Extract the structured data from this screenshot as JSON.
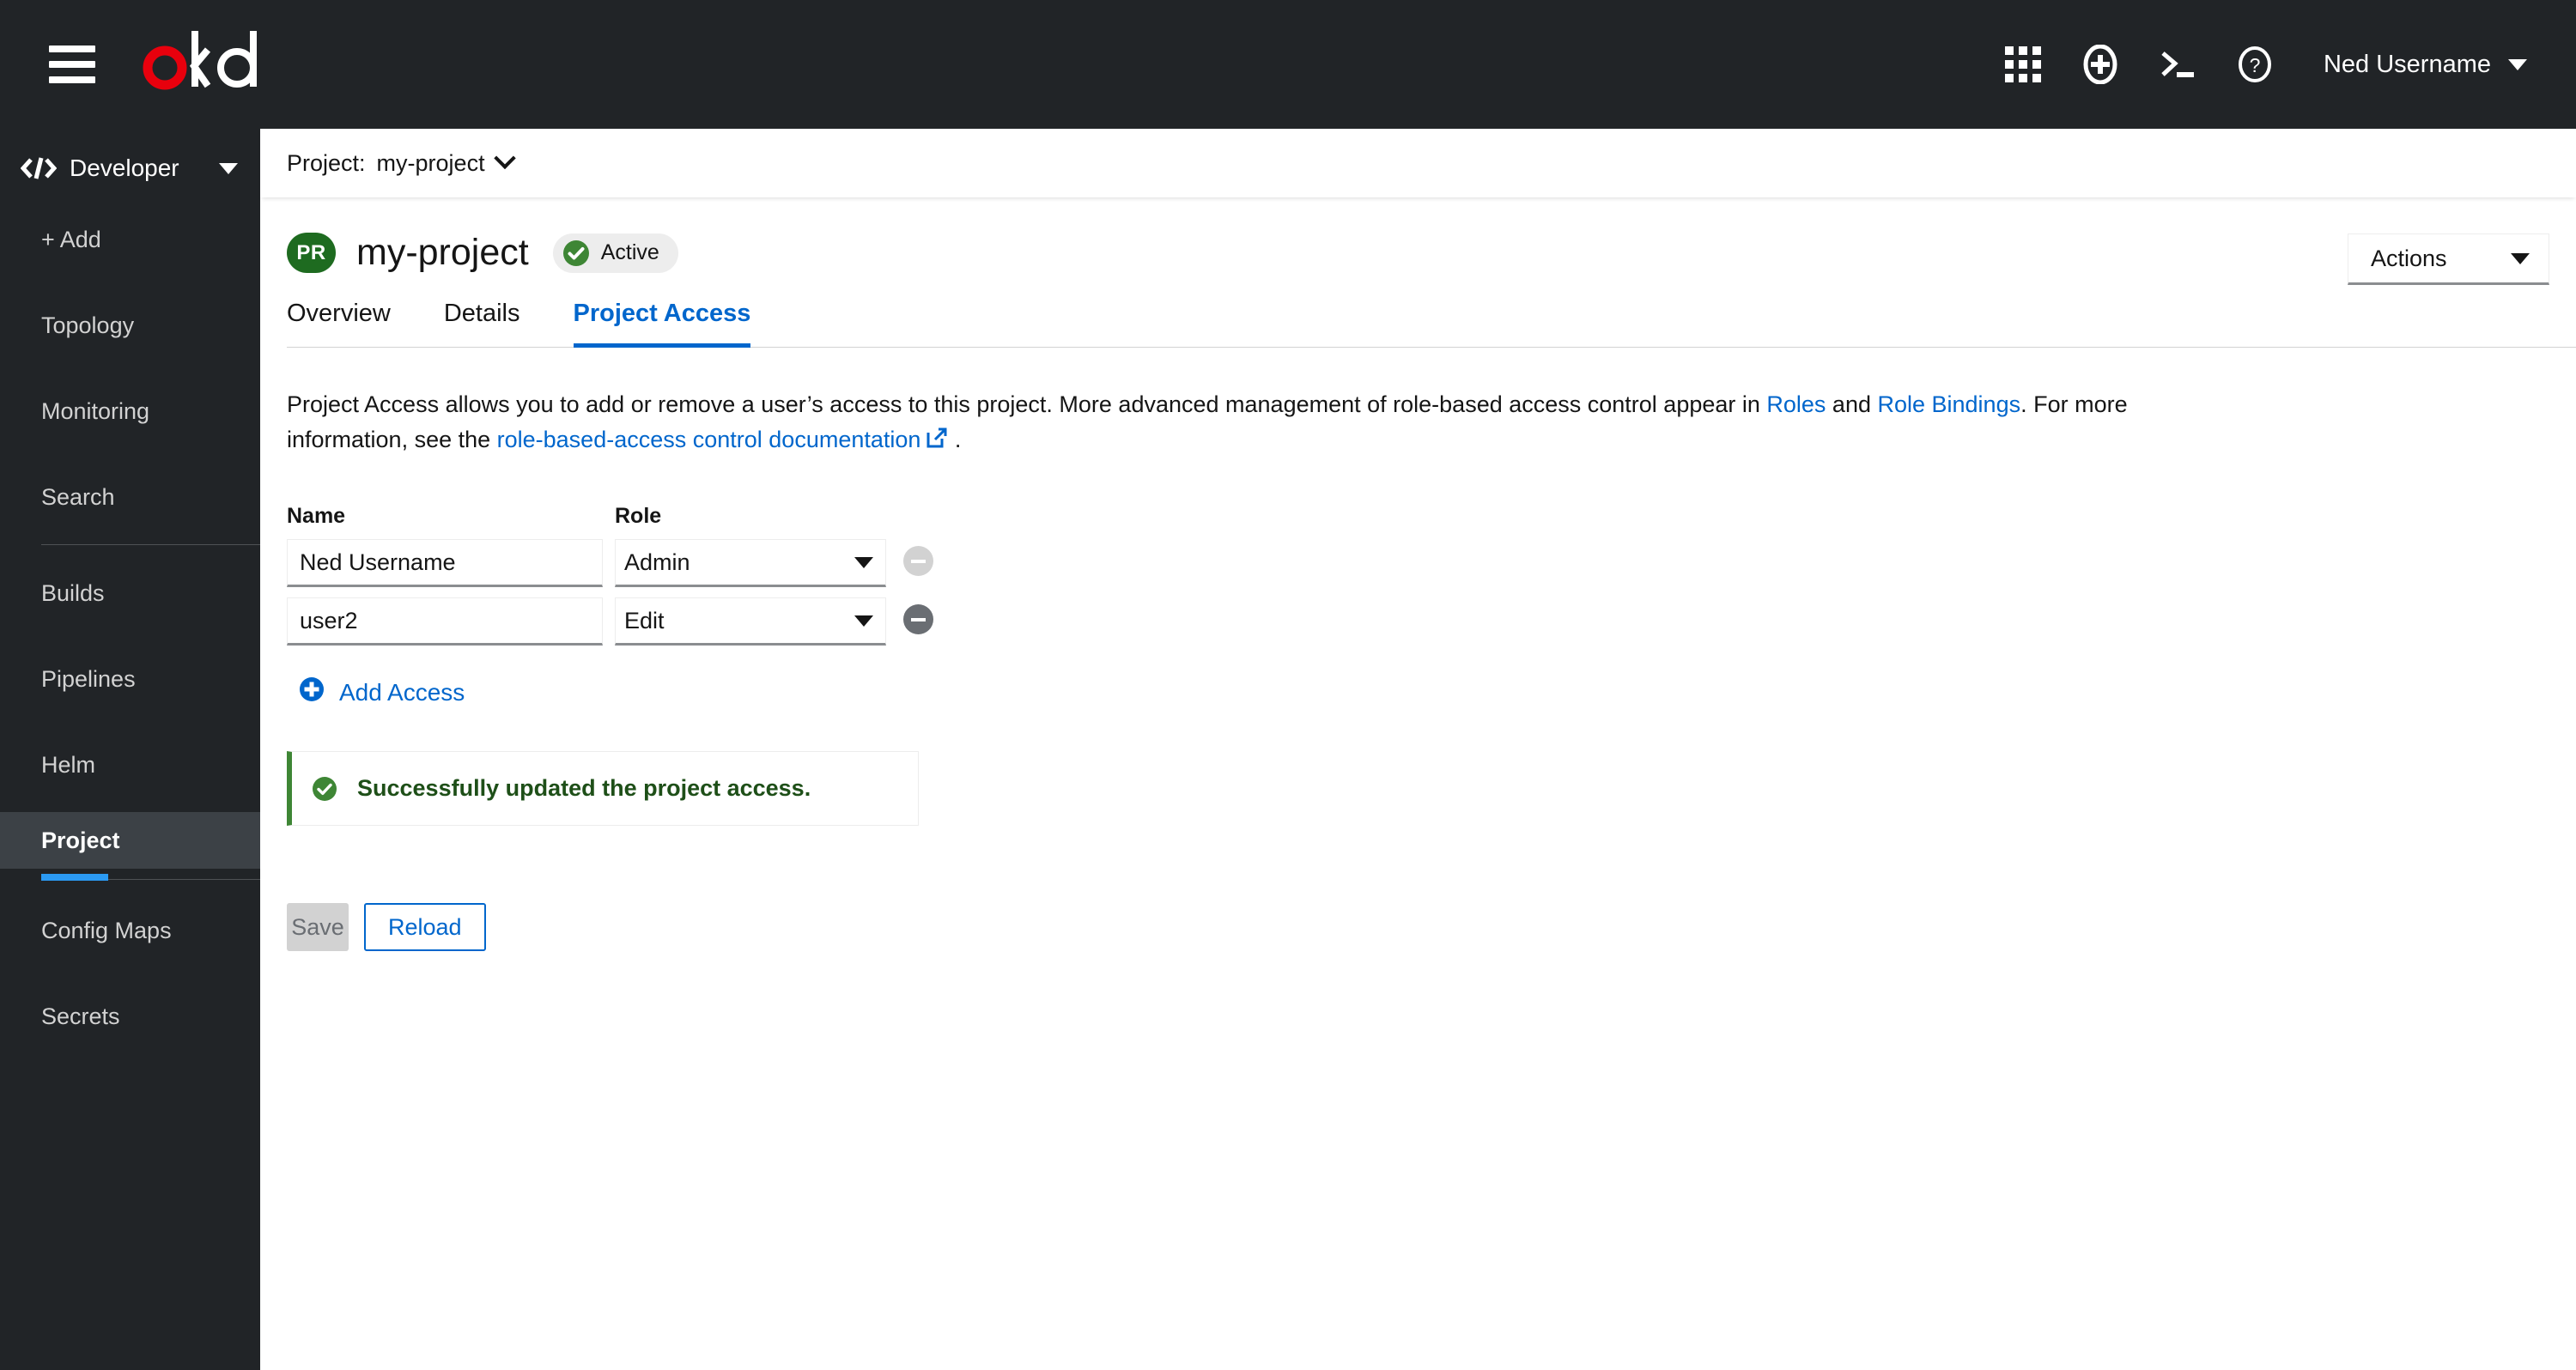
{
  "masthead": {
    "brand_name": "okd",
    "hamburger_label": "Toggle navigation",
    "icons": [
      {
        "name": "application-launcher-icon",
        "label": "Application launcher"
      },
      {
        "name": "plus-circle-icon",
        "label": "Quick create"
      },
      {
        "name": "terminal-icon",
        "label": "Command line terminal"
      },
      {
        "name": "help-icon",
        "label": "Help"
      }
    ],
    "user_name": "Ned Username"
  },
  "sidebar": {
    "perspective": "Developer",
    "items": [
      {
        "label": "+ Add",
        "active": false
      },
      {
        "label": "Topology",
        "active": false
      },
      {
        "label": "Monitoring",
        "active": false
      },
      {
        "label": "Search",
        "active": false
      },
      {
        "label": "Builds",
        "active": false
      },
      {
        "label": "Pipelines",
        "active": false
      },
      {
        "label": "Helm",
        "active": false
      },
      {
        "label": "Project",
        "active": true
      },
      {
        "label": "Config Maps",
        "active": false
      },
      {
        "label": "Secrets",
        "active": false
      }
    ]
  },
  "project_bar": {
    "label": "Project:",
    "value": "my-project"
  },
  "page": {
    "badge": "PR",
    "title": "my-project",
    "status": "Active",
    "actions_label": "Actions"
  },
  "tabs": [
    {
      "label": "Overview",
      "active": false
    },
    {
      "label": "Details",
      "active": false
    },
    {
      "label": "Project Access",
      "active": true
    }
  ],
  "description": {
    "part1": "Project Access allows you to add or remove a user’s access to this project.  More advanced management of role-based access control appear in ",
    "link_roles": "Roles",
    "part2": " and ",
    "link_rolebindings": "Role Bindings",
    "part3": ".  For more information, see the ",
    "link_docs": "role-based-access control documentation",
    "part4": " ."
  },
  "form": {
    "name_label": "Name",
    "role_label": "Role",
    "rows": [
      {
        "name": "Ned Username",
        "role": "Admin",
        "remove_enabled": false
      },
      {
        "name": "user2",
        "role": "Edit",
        "remove_enabled": true
      }
    ],
    "name_placeholder": "Name",
    "add_access_label": "Add Access"
  },
  "alert": {
    "message": "Successfully updated the project access.",
    "variant": "success"
  },
  "buttons": {
    "save": "Save",
    "save_disabled": true,
    "reload": "Reload"
  },
  "colors": {
    "masthead_bg": "#212427",
    "sidebar_bg": "#212427",
    "sidebar_active_bg": "#3c4146",
    "accent_blue": "#0066cc",
    "nav_accent_blue": "#2b9af3",
    "brand_red": "#e8000d",
    "success_green": "#3e8635",
    "badge_green": "#1e6b20"
  }
}
